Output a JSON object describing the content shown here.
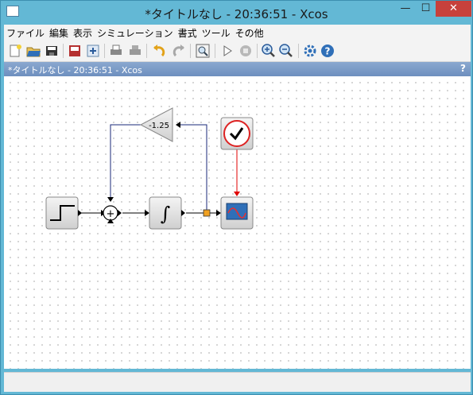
{
  "window": {
    "title": "*タイトルなし - 20:36:51 - Xcos"
  },
  "menu": [
    "ファイル",
    "編集",
    "表示",
    "シミュレーション",
    "書式",
    "ツール",
    "その他"
  ],
  "tab": {
    "title": "*タイトルなし - 20:36:51 - Xcos",
    "help": "?"
  },
  "diagram": {
    "gain_value": "-1.25",
    "sum_symbol": "+",
    "integral_symbol": "∫"
  },
  "toolbar": [
    "new-icon",
    "open-icon",
    "save-icon",
    "save-as-icon",
    "print-icon",
    "export-icon",
    "undo-icon",
    "redo-icon",
    "fit-zoom-icon",
    "start-icon",
    "stop-icon",
    "zoom-in-icon",
    "zoom-out-icon",
    "setup-icon",
    "help-icon"
  ]
}
